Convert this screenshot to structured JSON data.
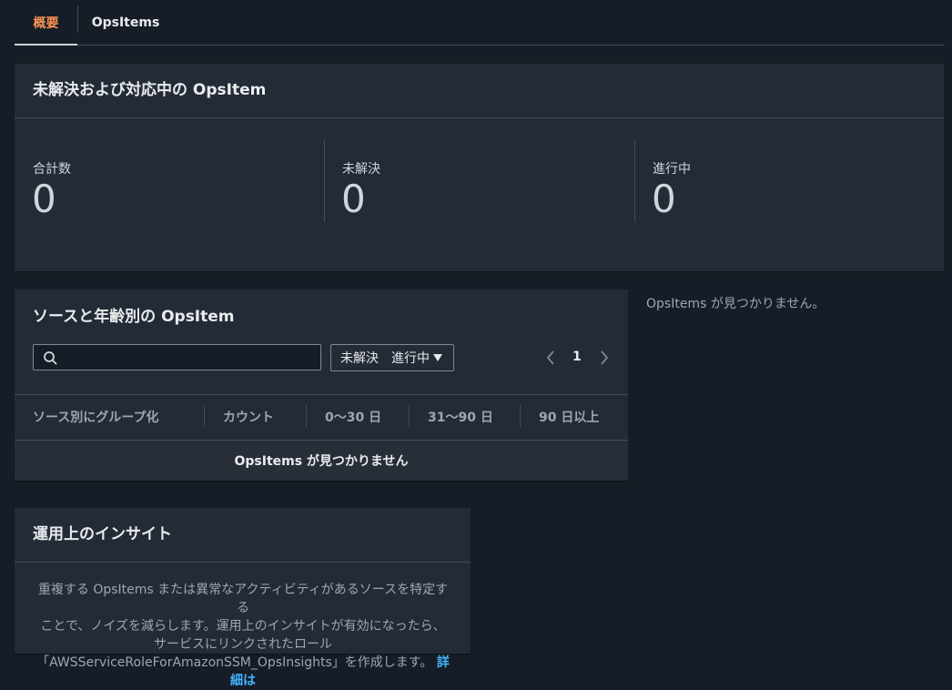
{
  "tabs": [
    {
      "label": "概要",
      "active": true
    },
    {
      "label": "OpsItems",
      "active": false
    }
  ],
  "summary": {
    "title": "未解決および対応中の OpsItem",
    "counts": [
      {
        "label": "合計数",
        "value": "0"
      },
      {
        "label": "未解決",
        "value": "0"
      },
      {
        "label": "進行中",
        "value": "0"
      }
    ]
  },
  "by_source": {
    "title": "ソースと年齢別の OpsItem",
    "search_placeholder": "",
    "filter_label": "未解決　進行中",
    "page_number": "1",
    "columns": [
      "ソース別にグループ化",
      "カウント",
      "0～30 日",
      "31～90 日",
      "90 日以上"
    ],
    "empty_message": "OpsItems が見つかりません"
  },
  "side_message": "OpsItems が見つかりません。",
  "insights": {
    "title": "運用上のインサイト",
    "text_lines": [
      "重複する OpsItems または異常なアクティビティがあるソースを特定する",
      "ことで、ノイズを減らします。運用上のインサイトが有効になったら、",
      "サービスにリンクされたロール",
      "「AWSServiceRoleForAmazonSSM_OpsInsights」を作成します。"
    ],
    "link_label": "詳細は"
  },
  "colors": {
    "background": "#161d26",
    "panel": "#232b37",
    "active_tab": "#f89256",
    "link": "#42b4ff"
  }
}
